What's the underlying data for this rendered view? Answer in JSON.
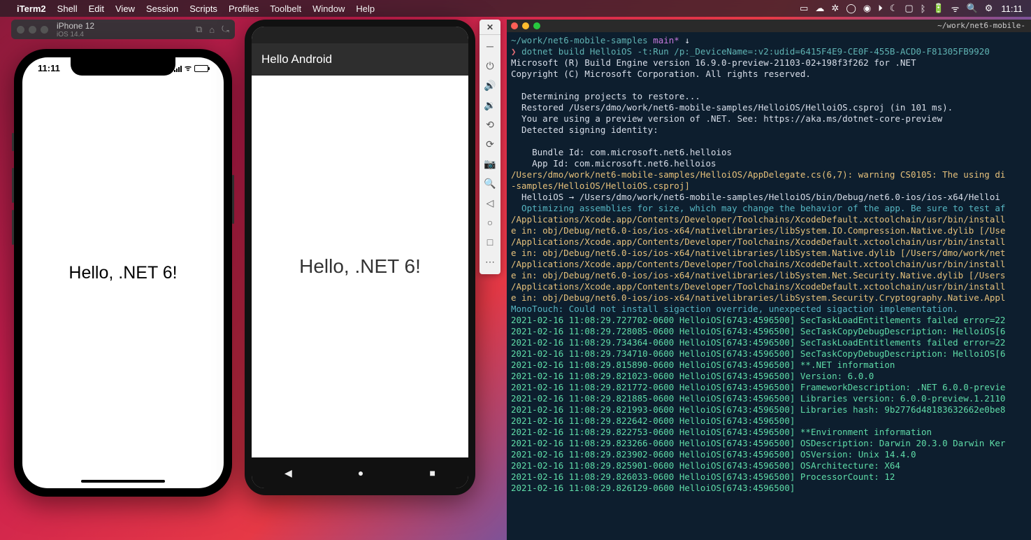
{
  "menubar": {
    "app": "iTerm2",
    "items": [
      "Shell",
      "Edit",
      "View",
      "Session",
      "Scripts",
      "Profiles",
      "Toolbelt",
      "Window",
      "Help"
    ],
    "time": "11:11"
  },
  "simulator_header": {
    "device": "iPhone 12",
    "os": "iOS 14.4"
  },
  "iphone": {
    "status_time": "11:11",
    "content": "Hello, .NET 6!"
  },
  "android": {
    "appbar_title": "Hello Android",
    "content": "Hello, .NET 6!"
  },
  "terminal": {
    "title": "~/work/net6-mobile-",
    "prompt_path": "~/work/net6-mobile-samples",
    "prompt_branch": "main*",
    "prompt_indicator": "↓",
    "command": "dotnet build HelloiOS -t:Run /p:_DeviceName=:v2:udid=6415F4E9-CE0F-455B-ACD0-F81305FB9920",
    "lines": [
      {
        "cls": "c-white",
        "text": "Microsoft (R) Build Engine version 16.9.0-preview-21103-02+198f3f262 for .NET"
      },
      {
        "cls": "c-white",
        "text": "Copyright (C) Microsoft Corporation. All rights reserved."
      },
      {
        "cls": "c-white",
        "text": ""
      },
      {
        "cls": "c-white",
        "text": "  Determining projects to restore..."
      },
      {
        "cls": "c-white",
        "text": "  Restored /Users/dmo/work/net6-mobile-samples/HelloiOS/HelloiOS.csproj (in 101 ms)."
      },
      {
        "cls": "c-white",
        "text": "  You are using a preview version of .NET. See: https://aka.ms/dotnet-core-preview"
      },
      {
        "cls": "c-white",
        "text": "  Detected signing identity:"
      },
      {
        "cls": "c-white",
        "text": ""
      },
      {
        "cls": "c-white",
        "text": "    Bundle Id: com.microsoft.net6.helloios"
      },
      {
        "cls": "c-white",
        "text": "    App Id: com.microsoft.net6.helloios"
      },
      {
        "cls": "c-warn",
        "text": "/Users/dmo/work/net6-mobile-samples/HelloiOS/AppDelegate.cs(6,7): warning CS0105: The using di"
      },
      {
        "cls": "c-warn",
        "text": "-samples/HelloiOS/HelloiOS.csproj]"
      },
      {
        "cls": "c-white",
        "text": "  HelloiOS → /Users/dmo/work/net6-mobile-samples/HelloiOS/bin/Debug/net6.0-ios/ios-x64/Helloi"
      },
      {
        "cls": "c-cyan",
        "text": "  Optimizing assemblies for size, which may change the behavior of the app. Be sure to test af"
      },
      {
        "cls": "c-warn",
        "text": "/Applications/Xcode.app/Contents/Developer/Toolchains/XcodeDefault.xctoolchain/usr/bin/install"
      },
      {
        "cls": "c-warn",
        "text": "e in: obj/Debug/net6.0-ios/ios-x64/nativelibraries/libSystem.IO.Compression.Native.dylib [/Use"
      },
      {
        "cls": "c-warn",
        "text": "/Applications/Xcode.app/Contents/Developer/Toolchains/XcodeDefault.xctoolchain/usr/bin/install"
      },
      {
        "cls": "c-warn",
        "text": "e in: obj/Debug/net6.0-ios/ios-x64/nativelibraries/libSystem.Native.dylib [/Users/dmo/work/net"
      },
      {
        "cls": "c-warn",
        "text": "/Applications/Xcode.app/Contents/Developer/Toolchains/XcodeDefault.xctoolchain/usr/bin/install"
      },
      {
        "cls": "c-warn",
        "text": "e in: obj/Debug/net6.0-ios/ios-x64/nativelibraries/libSystem.Net.Security.Native.dylib [/Users"
      },
      {
        "cls": "c-warn",
        "text": "/Applications/Xcode.app/Contents/Developer/Toolchains/XcodeDefault.xctoolchain/usr/bin/install"
      },
      {
        "cls": "c-warn",
        "text": "e in: obj/Debug/net6.0-ios/ios-x64/nativelibraries/libSystem.Security.Cryptography.Native.Appl"
      },
      {
        "cls": "c-cyan",
        "text": "MonoTouch: Could not install sigaction override, unexpected sigaction implementation."
      },
      {
        "cls": "c-green",
        "text": "2021-02-16 11:08:29.727702-0600 HelloiOS[6743:4596500] SecTaskLoadEntitlements failed error=22"
      },
      {
        "cls": "c-green",
        "text": "2021-02-16 11:08:29.728085-0600 HelloiOS[6743:4596500] SecTaskCopyDebugDescription: HelloiOS[6"
      },
      {
        "cls": "c-green",
        "text": "2021-02-16 11:08:29.734364-0600 HelloiOS[6743:4596500] SecTaskLoadEntitlements failed error=22"
      },
      {
        "cls": "c-green",
        "text": "2021-02-16 11:08:29.734710-0600 HelloiOS[6743:4596500] SecTaskCopyDebugDescription: HelloiOS[6"
      },
      {
        "cls": "c-green",
        "text": "2021-02-16 11:08:29.815890-0600 HelloiOS[6743:4596500] **.NET information"
      },
      {
        "cls": "c-green",
        "text": "2021-02-16 11:08:29.821023-0600 HelloiOS[6743:4596500] Version: 6.0.0"
      },
      {
        "cls": "c-green",
        "text": "2021-02-16 11:08:29.821772-0600 HelloiOS[6743:4596500] FrameworkDescription: .NET 6.0.0-previe"
      },
      {
        "cls": "c-green",
        "text": "2021-02-16 11:08:29.821885-0600 HelloiOS[6743:4596500] Libraries version: 6.0.0-preview.1.2110"
      },
      {
        "cls": "c-green",
        "text": "2021-02-16 11:08:29.821993-0600 HelloiOS[6743:4596500] Libraries hash: 9b2776d48183632662e0be8"
      },
      {
        "cls": "c-green",
        "text": "2021-02-16 11:08:29.822642-0600 HelloiOS[6743:4596500] "
      },
      {
        "cls": "c-green",
        "text": "2021-02-16 11:08:29.822753-0600 HelloiOS[6743:4596500] **Environment information"
      },
      {
        "cls": "c-green",
        "text": "2021-02-16 11:08:29.823266-0600 HelloiOS[6743:4596500] OSDescription: Darwin 20.3.0 Darwin Ker"
      },
      {
        "cls": "c-green",
        "text": "2021-02-16 11:08:29.823902-0600 HelloiOS[6743:4596500] OSVersion: Unix 14.4.0"
      },
      {
        "cls": "c-green",
        "text": "2021-02-16 11:08:29.825901-0600 HelloiOS[6743:4596500] OSArchitecture: X64"
      },
      {
        "cls": "c-green",
        "text": "2021-02-16 11:08:29.826033-0600 HelloiOS[6743:4596500] ProcessorCount: 12"
      },
      {
        "cls": "c-green",
        "text": "2021-02-16 11:08:29.826129-0600 HelloiOS[6743:4596500] "
      }
    ]
  }
}
